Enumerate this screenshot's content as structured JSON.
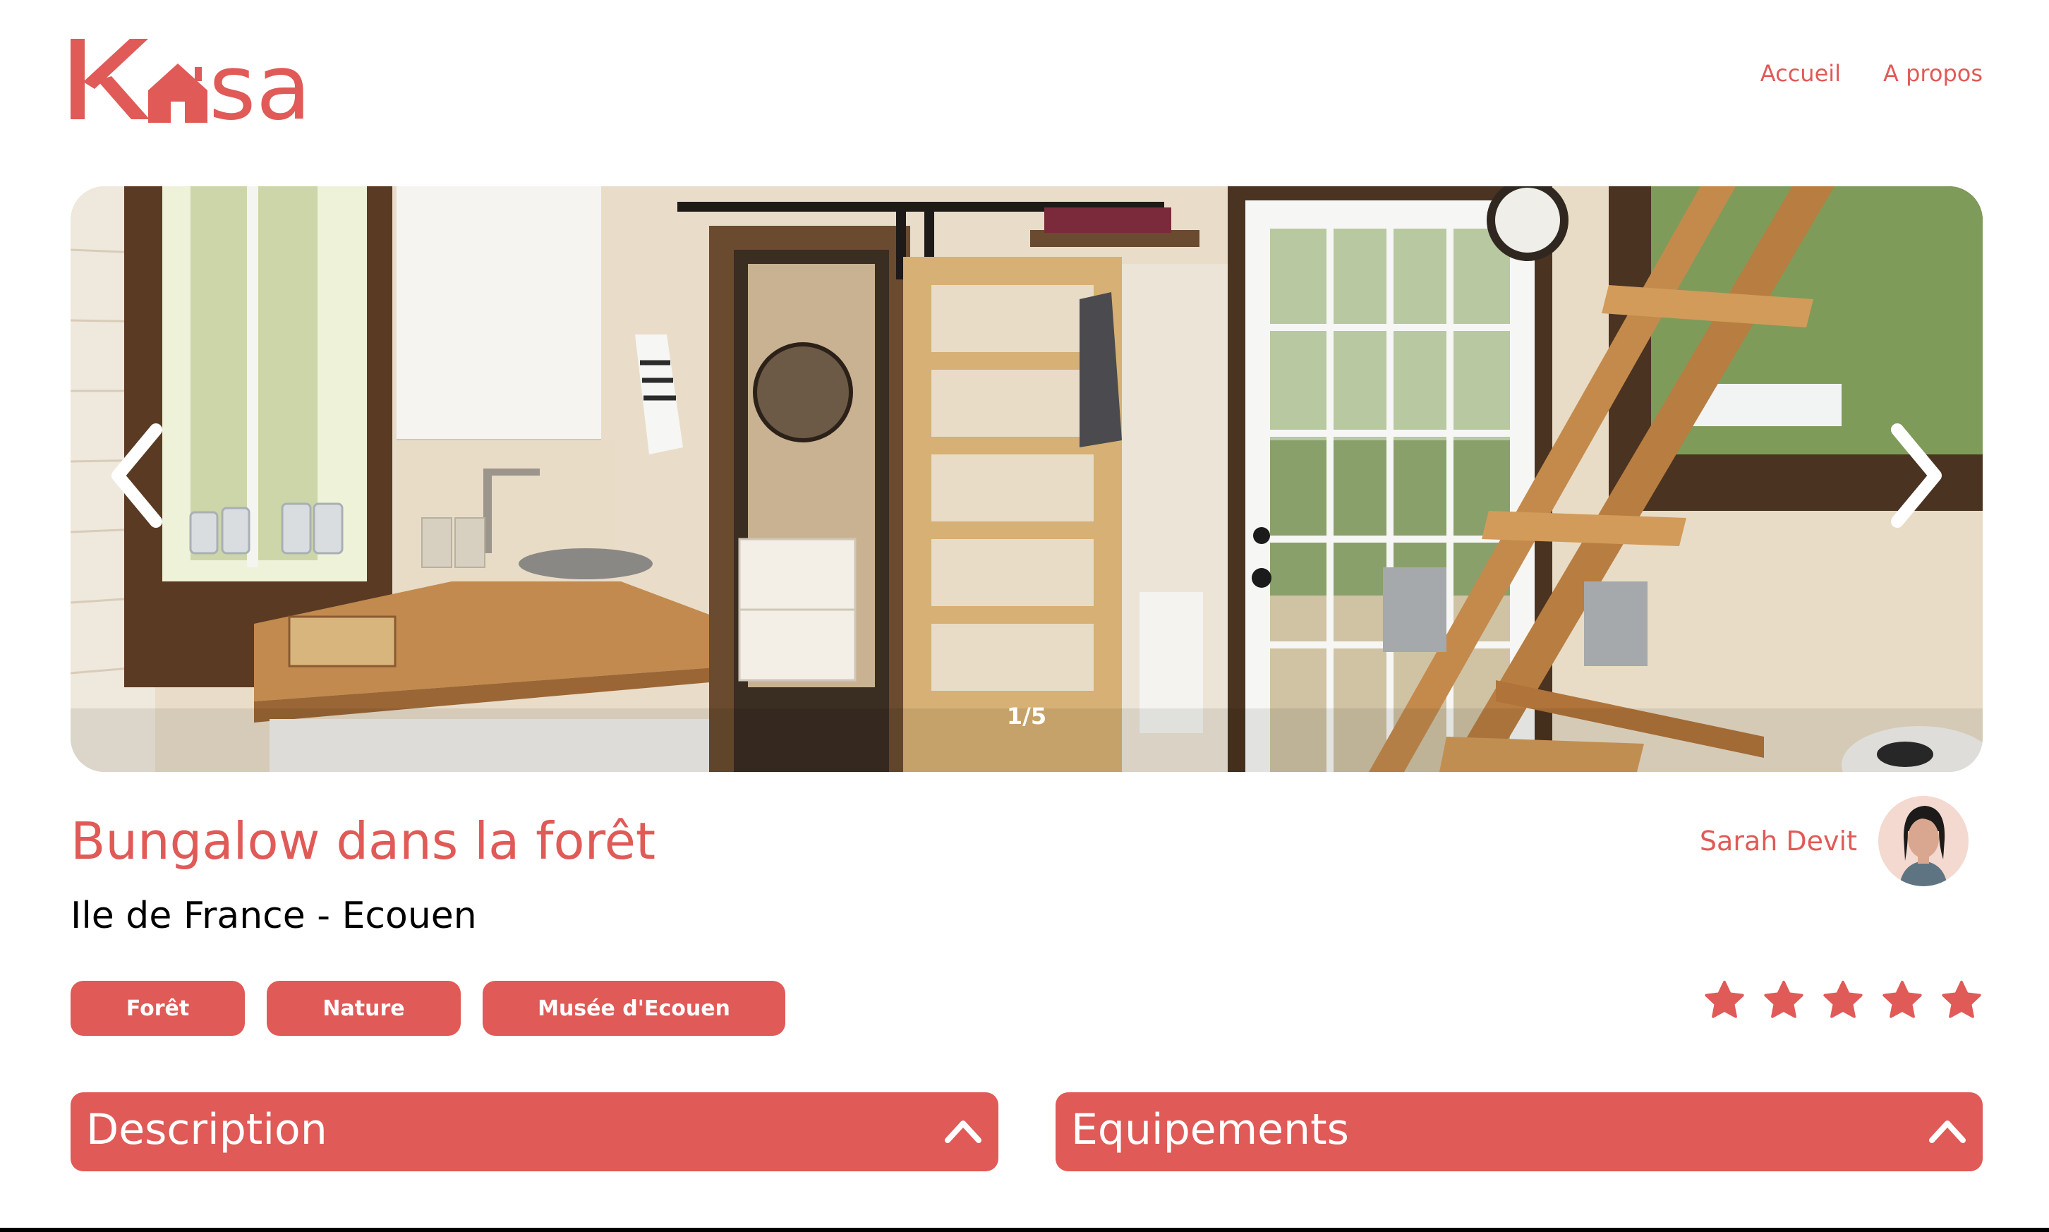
{
  "brand": {
    "logo_text": "Kasa",
    "accent_color": "#e05a57"
  },
  "nav": {
    "items": [
      {
        "label": "Accueil"
      },
      {
        "label": "A propos"
      }
    ]
  },
  "gallery": {
    "counter": "1/5",
    "prev_icon": "chevron-left-icon",
    "next_icon": "chevron-right-icon"
  },
  "listing": {
    "title": "Bungalow dans la forêt",
    "location": "Ile de France - Ecouen",
    "tags": [
      {
        "label": "Forêt"
      },
      {
        "label": "Nature"
      },
      {
        "label": "Musée d'Ecouen"
      }
    ],
    "host": {
      "name": "Sarah Devit"
    },
    "rating": {
      "value": 5,
      "max": 5,
      "icon": "star-icon"
    }
  },
  "sections": {
    "description": {
      "title": "Description",
      "icon": "chevron-up-icon"
    },
    "equipments": {
      "title": "Equipements",
      "icon": "chevron-up-icon"
    }
  }
}
